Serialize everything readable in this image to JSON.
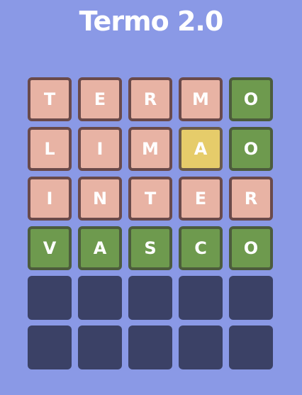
{
  "title": "Termo 2.0",
  "colors": {
    "background": "#8a99e6",
    "absent": "#e8b3a4",
    "correct": "#6e9a4e",
    "present": "#e6cc6a",
    "empty": "#3b4166"
  },
  "board": {
    "rows": [
      [
        {
          "letter": "T",
          "state": "absent"
        },
        {
          "letter": "E",
          "state": "absent"
        },
        {
          "letter": "R",
          "state": "absent"
        },
        {
          "letter": "M",
          "state": "absent"
        },
        {
          "letter": "O",
          "state": "correct"
        }
      ],
      [
        {
          "letter": "L",
          "state": "absent"
        },
        {
          "letter": "I",
          "state": "absent"
        },
        {
          "letter": "M",
          "state": "absent"
        },
        {
          "letter": "A",
          "state": "present"
        },
        {
          "letter": "O",
          "state": "correct"
        }
      ],
      [
        {
          "letter": "I",
          "state": "absent"
        },
        {
          "letter": "N",
          "state": "absent"
        },
        {
          "letter": "T",
          "state": "absent"
        },
        {
          "letter": "E",
          "state": "absent"
        },
        {
          "letter": "R",
          "state": "absent"
        }
      ],
      [
        {
          "letter": "V",
          "state": "correct"
        },
        {
          "letter": "A",
          "state": "correct"
        },
        {
          "letter": "S",
          "state": "correct"
        },
        {
          "letter": "C",
          "state": "correct"
        },
        {
          "letter": "O",
          "state": "correct"
        }
      ],
      [
        {
          "letter": "",
          "state": "empty"
        },
        {
          "letter": "",
          "state": "empty"
        },
        {
          "letter": "",
          "state": "empty"
        },
        {
          "letter": "",
          "state": "empty"
        },
        {
          "letter": "",
          "state": "empty"
        }
      ],
      [
        {
          "letter": "",
          "state": "empty"
        },
        {
          "letter": "",
          "state": "empty"
        },
        {
          "letter": "",
          "state": "empty"
        },
        {
          "letter": "",
          "state": "empty"
        },
        {
          "letter": "",
          "state": "empty"
        }
      ]
    ]
  }
}
